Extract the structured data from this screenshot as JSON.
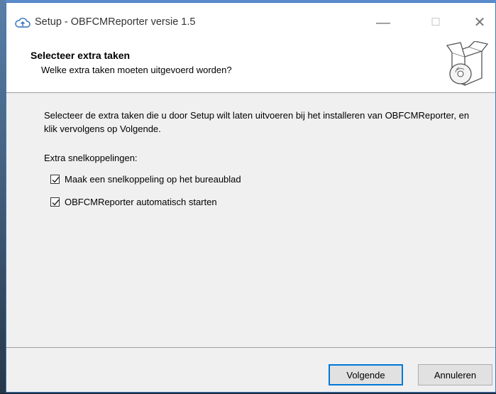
{
  "window": {
    "title": "Setup - OBFCMReporter versie 1.5"
  },
  "header": {
    "title": "Selecteer extra taken",
    "subtitle": "Welke extra taken moeten uitgevoerd worden?"
  },
  "content": {
    "description": "Selecteer de extra taken die u door Setup wilt laten uitvoeren bij het installeren van OBFCMReporter, en klik vervolgens op Volgende.",
    "group_label": "Extra snelkoppelingen:",
    "tasks": [
      {
        "label": "Maak een snelkoppeling op het bureaublad",
        "checked": true
      },
      {
        "label": "OBFCMReporter automatisch starten",
        "checked": true
      }
    ]
  },
  "buttons": {
    "next": "Volgende",
    "cancel": "Annuleren"
  },
  "icons": {
    "app": "cloud-upload-icon",
    "wizard": "software-box-cd-icon",
    "minimize": "minimize-icon",
    "maximize": "maximize-icon",
    "close": "close-icon"
  },
  "colors": {
    "accent": "#0078d7",
    "window_border": "#3c78c0"
  }
}
